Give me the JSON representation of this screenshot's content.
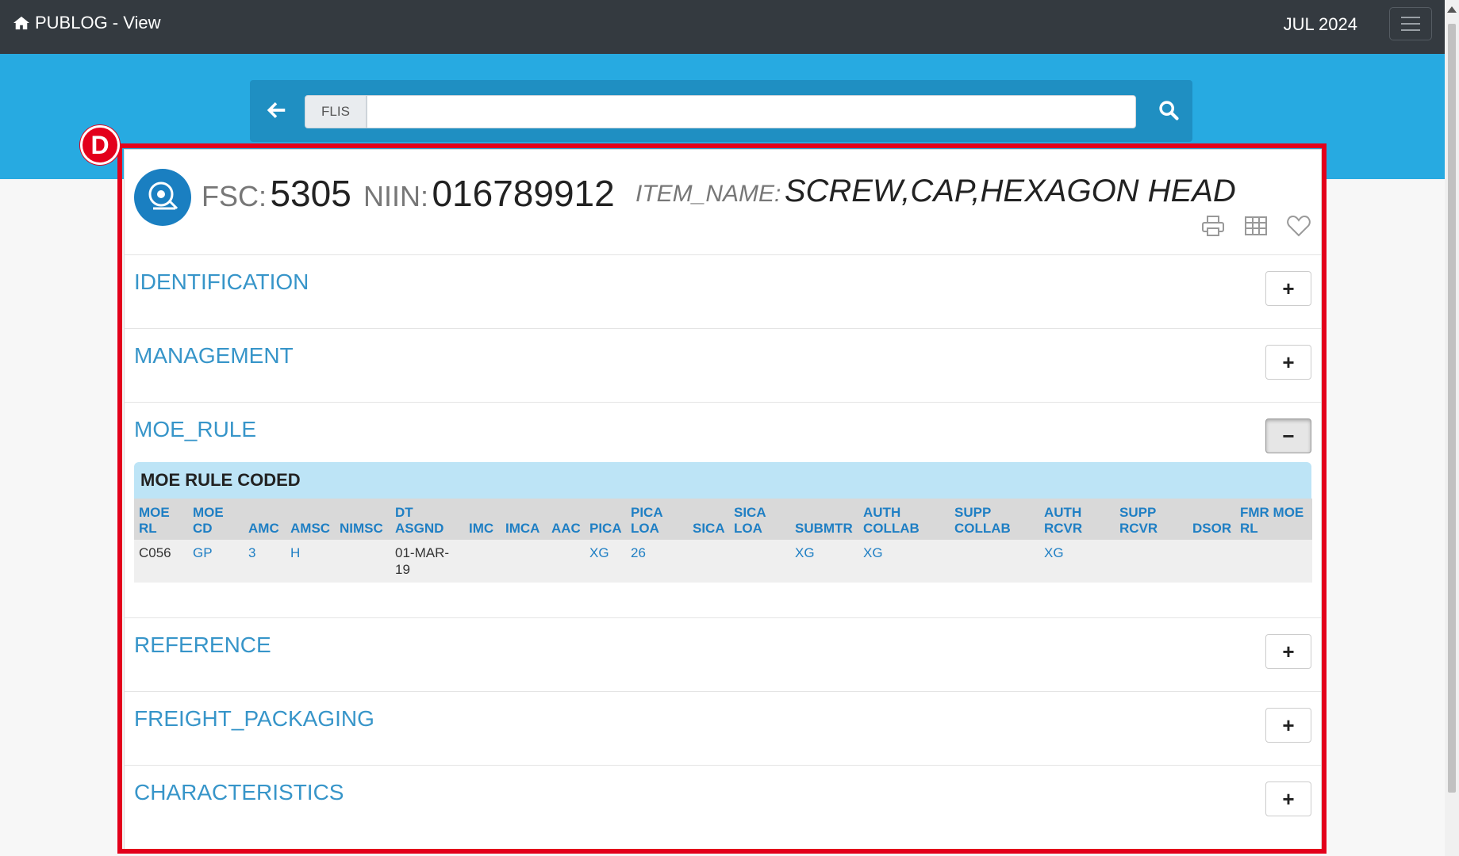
{
  "navbar": {
    "brand": "PUBLOG - View",
    "date": "JUL 2024"
  },
  "search": {
    "prefix": "FLIS",
    "value": ""
  },
  "marker": {
    "letter": "D"
  },
  "item": {
    "fsc_label": "FSC:",
    "fsc_value": "5305",
    "niin_label": "NIIN:",
    "niin_value": "016789912",
    "name_label": "ITEM_NAME:",
    "name_value": "SCREW,CAP,HEXAGON HEAD"
  },
  "sections": {
    "identification": {
      "title": "IDENTIFICATION",
      "toggle": "+"
    },
    "management": {
      "title": "MANAGEMENT",
      "toggle": "+"
    },
    "moe_rule": {
      "title": "MOE_RULE",
      "toggle": "−"
    },
    "reference": {
      "title": "REFERENCE",
      "toggle": "+"
    },
    "freight": {
      "title": "FREIGHT_PACKAGING",
      "toggle": "+"
    },
    "characteristics": {
      "title": "CHARACTERISTICS",
      "toggle": "+"
    }
  },
  "moe_table": {
    "title": "MOE RULE CODED",
    "headers": [
      [
        "MOE",
        "RL"
      ],
      [
        "MOE",
        "CD"
      ],
      [
        "",
        "AMC"
      ],
      [
        "",
        "AMSC"
      ],
      [
        "",
        "NIMSC"
      ],
      [
        "DT",
        "ASGND"
      ],
      [
        "",
        "IMC"
      ],
      [
        "",
        "IMCA"
      ],
      [
        "",
        "AAC"
      ],
      [
        "",
        "PICA"
      ],
      [
        "PICA",
        "LOA"
      ],
      [
        "",
        "SICA"
      ],
      [
        "SICA",
        "LOA"
      ],
      [
        "",
        "SUBMTR"
      ],
      [
        "AUTH",
        "COLLAB"
      ],
      [
        "SUPP",
        "COLLAB"
      ],
      [
        "AUTH",
        "RCVR"
      ],
      [
        "SUPP",
        "RCVR"
      ],
      [
        "",
        "DSOR"
      ],
      [
        "FMR MOE",
        "RL"
      ]
    ],
    "row": [
      "C056",
      "GP",
      "3",
      "H",
      "",
      "01-MAR-19",
      "",
      "",
      "",
      "XG",
      "26",
      "",
      "",
      "XG",
      "XG",
      "",
      "XG",
      "",
      "",
      ""
    ]
  },
  "icons": [
    "home-icon",
    "menu-icon",
    "back-arrow-icon",
    "search-icon",
    "item-logo-icon",
    "print-icon",
    "table-icon",
    "heart-icon"
  ]
}
